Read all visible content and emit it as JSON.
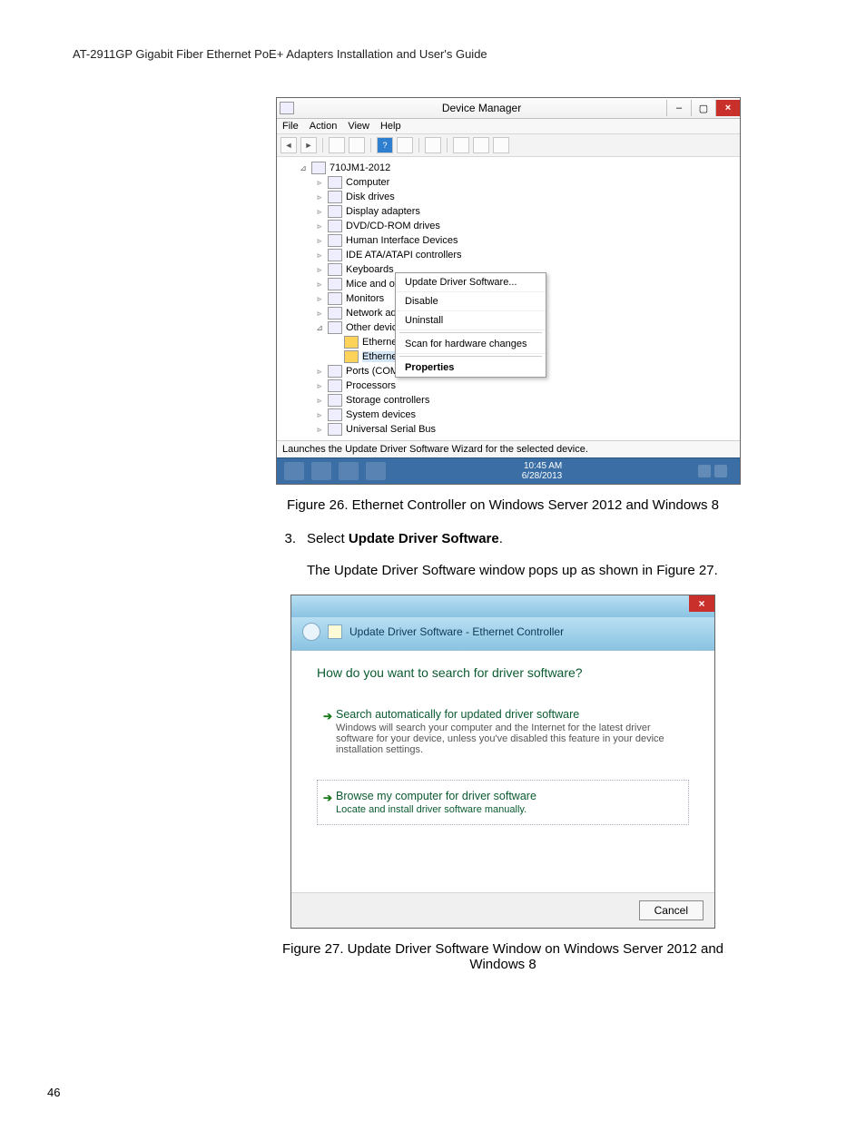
{
  "header": "AT-2911GP Gigabit Fiber Ethernet PoE+ Adapters Installation and User's Guide",
  "page_number": "46",
  "caption1": "Figure 26. Ethernet Controller on Windows Server 2012 and Windows 8",
  "step": {
    "num": "3.",
    "prefix": "Select ",
    "bold": "Update Driver Software",
    "suffix": "."
  },
  "paragraph": "The Update Driver Software window pops up as shown in Figure 27.",
  "caption2": "Figure 27. Update Driver Software Window on Windows Server 2012 and Windows 8",
  "dm": {
    "title": "Device Manager",
    "menus": [
      "File",
      "Action",
      "View",
      "Help"
    ],
    "root": "710JM1-2012",
    "nodes": [
      "Computer",
      "Disk drives",
      "Display adapters",
      "DVD/CD-ROM drives",
      "Human Interface Devices",
      "IDE ATA/ATAPI controllers",
      "Keyboards",
      "Mice and other pointing devices",
      "Monitors",
      "Network adapters"
    ],
    "other_devices": "Other devices",
    "other_children": [
      "Ethernet Controller",
      "Ethernet Contro"
    ],
    "tail_nodes": [
      "Ports (COM & LPT)",
      "Processors",
      "Storage controllers",
      "System devices",
      "Universal Serial Bus"
    ],
    "context_menu": [
      "Update Driver Software...",
      "Disable",
      "Uninstall",
      "Scan for hardware changes",
      "Properties"
    ],
    "status": "Launches the Update Driver Software Wizard for the selected device.",
    "clock": {
      "time": "10:45 AM",
      "date": "6/28/2013"
    }
  },
  "ud": {
    "header": "Update Driver Software - Ethernet Controller",
    "heading": "How do you want to search for driver software?",
    "opt1_title": "Search automatically for updated driver software",
    "opt1_sub": "Windows will search your computer and the Internet for the latest driver software for your device, unless you've disabled this feature in your device installation settings.",
    "opt2_title": "Browse my computer for driver software",
    "opt2_sub": "Locate and install driver software manually.",
    "cancel": "Cancel"
  }
}
